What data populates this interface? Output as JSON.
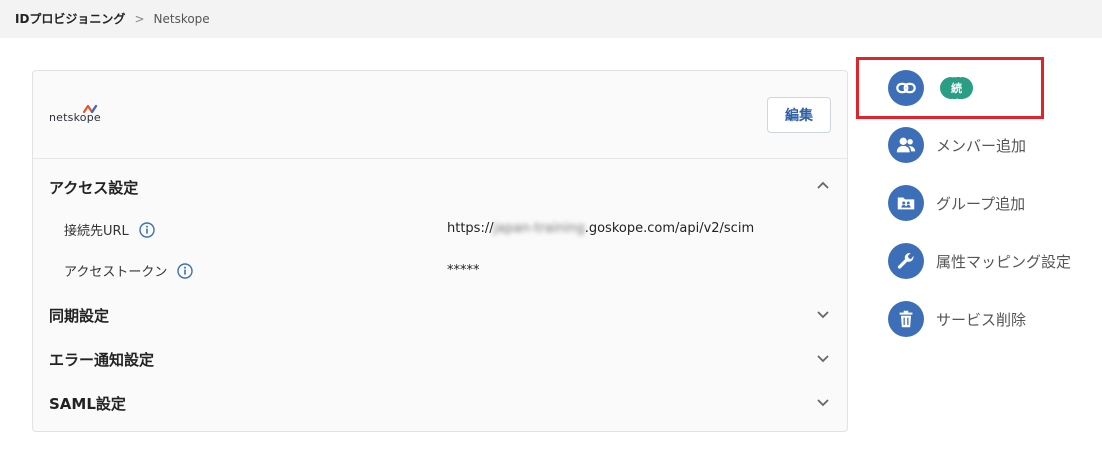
{
  "breadcrumb": {
    "parent": "IDプロビジョニング",
    "separator": ">",
    "current": "Netskope"
  },
  "card": {
    "logo_text": "netskope",
    "edit_label": "編集",
    "sections": {
      "access": {
        "title": "アクセス設定",
        "rows": [
          {
            "label": "接続先URL",
            "value_prefix": "https://",
            "value_blurred": "japan-training",
            "value_suffix": ".goskope.com/api/v2/scim"
          },
          {
            "label": "アクセストークン",
            "value": "*****"
          }
        ]
      },
      "sync": {
        "title": "同期設定"
      },
      "error": {
        "title": "エラー通知設定"
      },
      "saml": {
        "title": "SAML設定"
      }
    }
  },
  "sidebar": {
    "connection_badge": "接続済",
    "items": [
      {
        "label": "メンバー追加",
        "icon": "users-icon"
      },
      {
        "label": "グループ追加",
        "icon": "group-folder-icon"
      },
      {
        "label": "属性マッピング設定",
        "icon": "wrench-icon"
      },
      {
        "label": "サービス削除",
        "icon": "trash-icon"
      }
    ]
  },
  "colors": {
    "accent_blue": "#3d6fb8",
    "badge_green": "#2a9d84",
    "highlight_red": "#e0242b",
    "link_blue": "#2f5fa8"
  }
}
